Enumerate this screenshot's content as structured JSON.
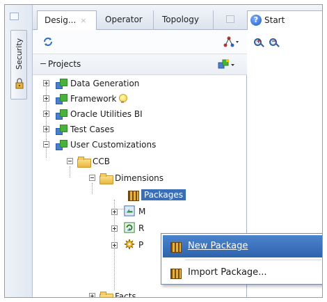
{
  "side_strip": {
    "security_label": "Security"
  },
  "tabs": [
    {
      "label": "Desig...",
      "close": "×",
      "active": true
    },
    {
      "label": "Operator",
      "active": false
    },
    {
      "label": "Topology",
      "active": false
    }
  ],
  "start_tab": {
    "label": "Start",
    "help_glyph": "?"
  },
  "designer": {
    "projects_label": "Projects"
  },
  "tree": [
    {
      "label": "Data Generation",
      "icon": "project-icon"
    },
    {
      "label": "Framework",
      "icon": "project-icon",
      "badge": "lightbulb-icon"
    },
    {
      "label": "Oracle Utilities BI",
      "icon": "project-icon"
    },
    {
      "label": "Test Cases",
      "icon": "project-icon"
    },
    {
      "label": "User Customizations",
      "icon": "project-icon"
    },
    {
      "label": "CCB",
      "icon": "folder-icon"
    },
    {
      "label": "Dimensions",
      "icon": "folder-icon"
    },
    {
      "label": "Packages",
      "icon": "package-icon",
      "selected": true
    },
    {
      "label": "M",
      "icon": "mapping-icon"
    },
    {
      "label": "R",
      "icon": "reusable-mapping-icon"
    },
    {
      "label": "P",
      "icon": "procedure-icon"
    },
    {
      "label": "Facts",
      "icon": "folder-icon"
    }
  ],
  "context_menu": {
    "items": [
      {
        "label": "New Package",
        "icon": "package-icon",
        "highlighted": true
      },
      {
        "label": "Import Package...",
        "icon": "package-icon",
        "highlighted": false
      }
    ]
  },
  "colors": {
    "selection": "#3a6fb8",
    "menu_highlight": "#2f64ad",
    "panel_border": "#aab6c8"
  }
}
